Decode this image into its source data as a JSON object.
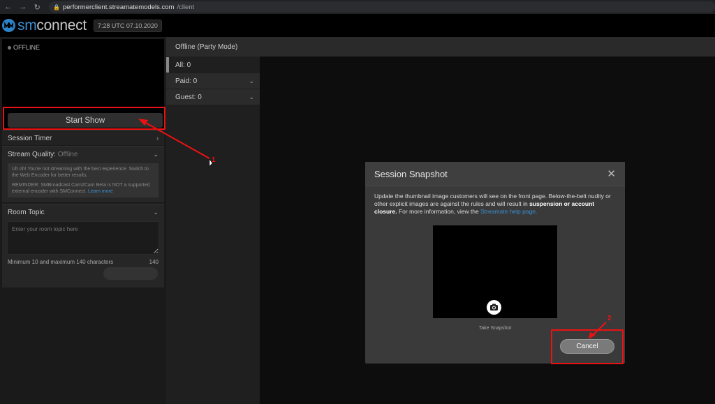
{
  "browser": {
    "url_host": "performerclient.streamatemodels.com",
    "url_path": "/client"
  },
  "header": {
    "logo_sm": "sm",
    "logo_connect": "connect",
    "clock": "7:28 UTC 07.10.2020"
  },
  "left": {
    "status": "OFFLINE",
    "start_show": "Start Show",
    "session_timer": "Session Timer",
    "stream_quality_label": "Stream Quality:",
    "stream_quality_value": "Offline",
    "stream_msg": "Uh oh! You're not streaming with the best experience. Switch to the Web Encoder for better results.",
    "reminder": "REMINDER: SMBroadcast Cam2Cam Beta is NOT a supported external encoder with SMConnect.",
    "learn_more": "Learn more",
    "room_topic": "Room Topic",
    "topic_placeholder": "Enter your room topic here",
    "topic_rule": "Minimum 10 and maximum 140 characters",
    "topic_count": "140"
  },
  "main": {
    "title": "Offline (Party Mode)",
    "filters": [
      {
        "label": "All: 0"
      },
      {
        "label": "Paid: 0"
      },
      {
        "label": "Guest: 0"
      }
    ]
  },
  "modal": {
    "title": "Session Snapshot",
    "text_1": "Update the thumbnail image customers will see on the front page. Below-the-belt nudity or other explicit images are against the rules and will result in ",
    "text_bold": "suspension or account closure.",
    "text_2": " For more information, view the ",
    "help_link": "Streamate help page.",
    "take_snapshot": "Take Snapshot",
    "cancel": "Cancel"
  },
  "annotations": {
    "marker_1": "1",
    "marker_2": "2",
    "color": "#e11111"
  }
}
